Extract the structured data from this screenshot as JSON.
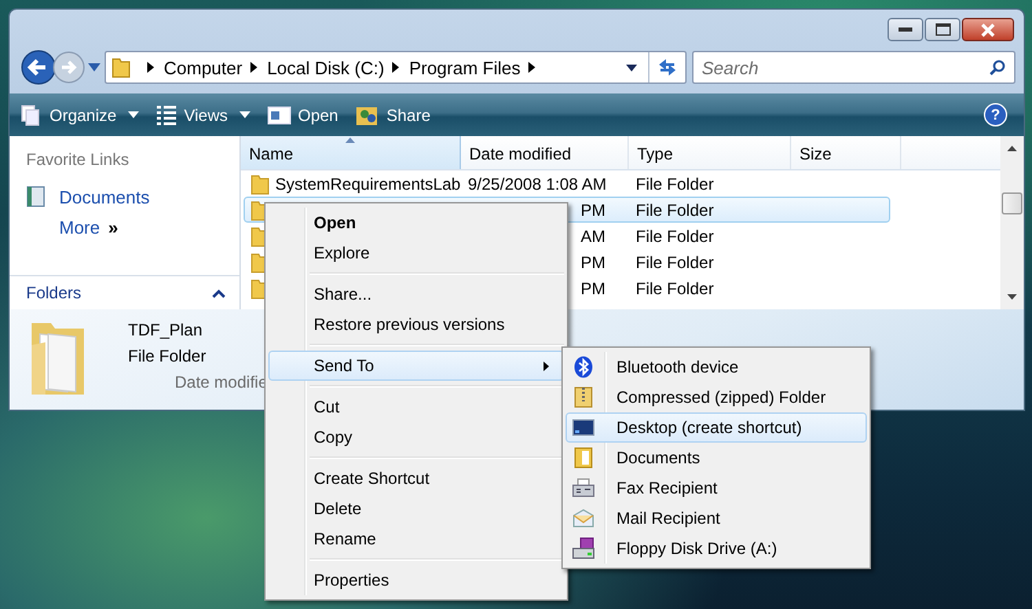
{
  "address": {
    "breadcrumbs": [
      "Computer",
      "Local Disk (C:)",
      "Program Files"
    ]
  },
  "search": {
    "placeholder": "Search"
  },
  "toolbar": [
    {
      "label": "Organize",
      "kind": "dropdown"
    },
    {
      "label": "Views",
      "kind": "dropdown"
    },
    {
      "label": "Open",
      "kind": "open"
    },
    {
      "label": "Share",
      "kind": "share"
    }
  ],
  "help": {
    "label": "?"
  },
  "favorite_links": {
    "title": "Favorite Links",
    "items": [
      {
        "label": "Documents",
        "kind": "documents"
      },
      {
        "label": "More",
        "kind": "more",
        "chevron": "»"
      }
    ]
  },
  "folders": {
    "label": "Folders",
    "expanded": false
  },
  "table": {
    "columns": [
      {
        "label": "Name",
        "sorted": true
      },
      {
        "label": "Date modified",
        "sorted": false
      },
      {
        "label": "Type",
        "sorted": false
      },
      {
        "label": "Size",
        "sorted": false
      }
    ],
    "rows": [
      {
        "name": "SystemRequirementsLab",
        "date": "9/25/2008 1:08 AM",
        "type": "File Folder",
        "selected": false,
        "covered": false
      },
      {
        "date": "PM",
        "type": "File Folder",
        "selected": true,
        "covered": true
      },
      {
        "date": "AM",
        "type": "File Folder",
        "selected": false,
        "covered": true
      },
      {
        "date": "PM",
        "type": "File Folder",
        "selected": false,
        "covered": true
      },
      {
        "date": "PM",
        "type": "File Folder",
        "selected": false,
        "covered": true
      }
    ]
  },
  "details": {
    "name": "TDF_Plan",
    "type": "File Folder",
    "date_label": "Date modifie"
  },
  "context_menu": [
    {
      "kind": "item",
      "label": "Open",
      "default": true,
      "selected": false
    },
    {
      "kind": "item",
      "label": "Explore",
      "default": false,
      "selected": false
    },
    {
      "kind": "separator"
    },
    {
      "kind": "item",
      "label": "Share...",
      "default": false,
      "selected": false
    },
    {
      "kind": "item",
      "label": "Restore previous versions",
      "default": false,
      "selected": false
    },
    {
      "kind": "separator"
    },
    {
      "kind": "submenu",
      "label": "Send To",
      "default": false,
      "selected": true
    },
    {
      "kind": "separator"
    },
    {
      "kind": "item",
      "label": "Cut",
      "default": false,
      "selected": false
    },
    {
      "kind": "item",
      "label": "Copy",
      "default": false,
      "selected": false
    },
    {
      "kind": "separator"
    },
    {
      "kind": "item",
      "label": "Create Shortcut",
      "default": false,
      "selected": false
    },
    {
      "kind": "item",
      "label": "Delete",
      "default": false,
      "selected": false
    },
    {
      "kind": "item",
      "label": "Rename",
      "default": false,
      "selected": false
    },
    {
      "kind": "separator"
    },
    {
      "kind": "item",
      "label": "Properties",
      "default": false,
      "selected": false
    }
  ],
  "send_to_menu": [
    {
      "kind": "bluetooth",
      "label": "Bluetooth device",
      "selected": false
    },
    {
      "kind": "zip",
      "label": "Compressed (zipped) Folder",
      "selected": false
    },
    {
      "kind": "desktop",
      "label": "Desktop (create shortcut)",
      "selected": true
    },
    {
      "kind": "documents",
      "label": "Documents",
      "selected": false
    },
    {
      "kind": "fax",
      "label": "Fax Recipient",
      "selected": false
    },
    {
      "kind": "mail",
      "label": "Mail Recipient",
      "selected": false
    },
    {
      "kind": "floppy",
      "label": "Floppy Disk Drive (A:)",
      "selected": false
    }
  ]
}
